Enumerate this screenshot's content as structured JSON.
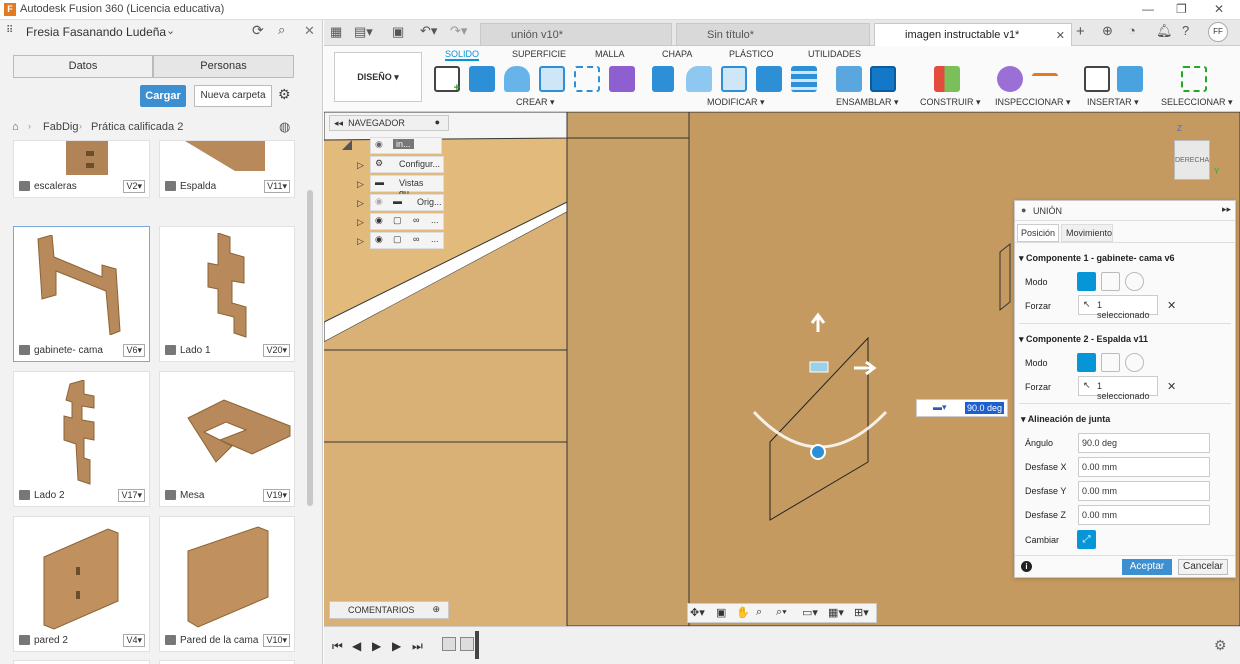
{
  "window": {
    "title": "Autodesk Fusion 360 (Licencia educativa)",
    "app_icon": "F"
  },
  "user": {
    "name": "Fresia Fasanando Ludeña",
    "initials": "FF"
  },
  "data_panel": {
    "tabs": [
      "Datos",
      "Personas"
    ],
    "upload_label": "Cargar",
    "new_folder_label": "Nueva carpeta",
    "breadcrumb": [
      "FabDig",
      "Prática calificada 2"
    ],
    "items": [
      {
        "name": "escaleras",
        "version": "V2▾"
      },
      {
        "name": "Espalda",
        "version": "V11▾"
      },
      {
        "name": "gabinete- cama",
        "version": "V6▾"
      },
      {
        "name": "Lado 1",
        "version": "V20▾"
      },
      {
        "name": "Lado 2",
        "version": "V17▾"
      },
      {
        "name": "Mesa",
        "version": "V19▾"
      },
      {
        "name": "pared 2",
        "version": "V4▾"
      },
      {
        "name": "Pared de la cama",
        "version": "V10▾"
      }
    ]
  },
  "doc_tabs": [
    "unión v10*",
    "Sin título*",
    "imagen instructable v1*"
  ],
  "toolbar": {
    "workspace": "DISEÑO ▾",
    "tabs": [
      "SOLIDO",
      "SUPERFICIE",
      "MALLA",
      "CHAPA",
      "PLÁSTICO",
      "UTILIDADES"
    ],
    "groups": [
      "CREAR ▾",
      "MODIFICAR ▾",
      "ENSAMBLAR ▾",
      "CONSTRUIR ▾",
      "INSPECCIONAR ▾",
      "INSERTAR ▾",
      "SELECCIONAR ▾"
    ]
  },
  "browser": {
    "title": "NAVEGADOR",
    "rows": [
      "in...",
      "Configur...",
      "Vistas gu...",
      "Orig...",
      "...",
      "..."
    ],
    "comments": "COMENTARIOS"
  },
  "viewcube": {
    "face": "DERECHA",
    "axis_z": "Z",
    "axis_y": "Y"
  },
  "joint_panel": {
    "title": "UNIÓN",
    "tabs": [
      "Posición",
      "Movimiento"
    ],
    "comp1_header": "Componente 1 - gabinete- cama v6",
    "comp2_header": "Componente 2 - Espalda v11",
    "mode_label": "Modo",
    "force_label": "Forzar",
    "selected_text": "1 seleccionado",
    "align_header": "Alineación de junta",
    "angle_label": "Ángulo",
    "angle_value": "90.0 deg",
    "offset_x_label": "Desfase X",
    "offset_x_value": "0.00 mm",
    "offset_y_label": "Desfase Y",
    "offset_y_value": "0.00 mm",
    "offset_z_label": "Desfase Z",
    "offset_z_value": "0.00 mm",
    "flip_label": "Cambiar",
    "ok_label": "Aceptar",
    "cancel_label": "Cancelar"
  },
  "angle_input": "90.0 deg",
  "colors": {
    "accent": "#0696d7",
    "wood": "#c9a061",
    "button_blue": "#3c8fd1"
  }
}
